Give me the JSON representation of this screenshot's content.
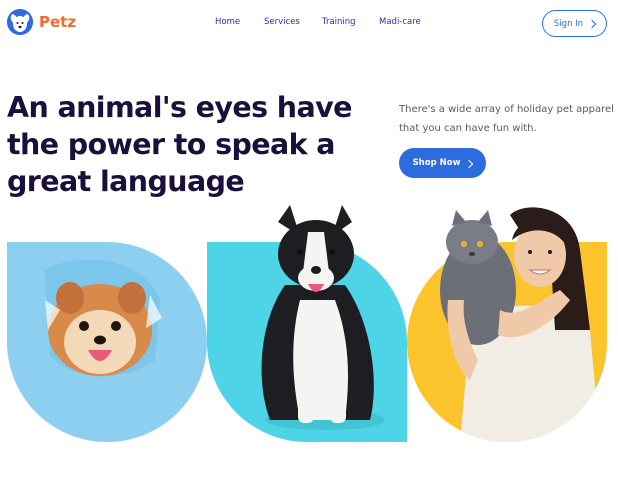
{
  "brand": {
    "name": "Petz"
  },
  "nav": {
    "items": [
      "Home",
      "Services",
      "Training",
      "Madi-care"
    ],
    "signin_label": "Sign In"
  },
  "hero": {
    "headline_lines": [
      "An animal's eyes have",
      "the power to speak a",
      "great language"
    ],
    "tagline_lines": [
      "There's a wide array of holiday pet apparel",
      "that you can have fun with."
    ],
    "cta_label": "Shop Now"
  },
  "colors": {
    "accent": "#2d6cdf",
    "logo_text": "#f26a2e",
    "heading": "#1b0f3b",
    "panel_blue": "#8ccff0",
    "panel_cyan": "#4dd4e6",
    "panel_yellow": "#fbc42c"
  },
  "icons": {
    "logo": "dog-face-icon",
    "signin": "chevron-right-icon",
    "cta": "chevron-right-icon"
  }
}
